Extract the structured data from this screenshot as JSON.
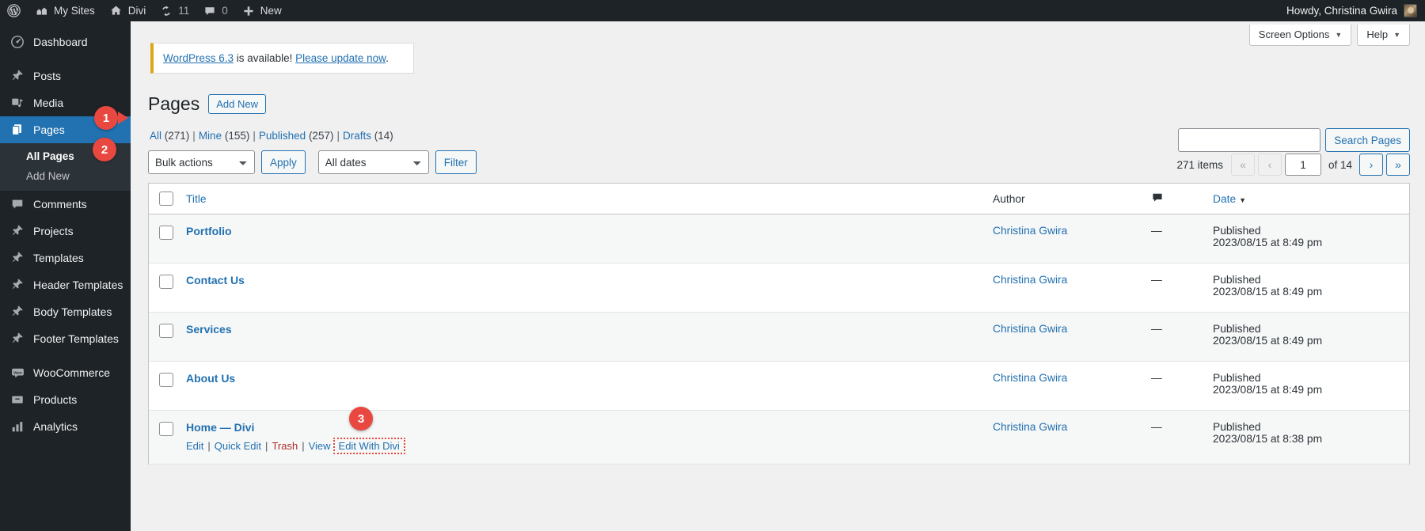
{
  "adminbar": {
    "items": [
      {
        "icon": "wordpress-logo-icon",
        "label": ""
      },
      {
        "icon": "my-sites-icon",
        "label": "My Sites"
      },
      {
        "icon": "home-icon",
        "label": "Divi"
      },
      {
        "icon": "updates-icon",
        "label": "11"
      },
      {
        "icon": "comments-bubble-icon",
        "label": "0"
      },
      {
        "icon": "plus-icon",
        "label": "New"
      }
    ],
    "howdy": "Howdy, Christina Gwira"
  },
  "sidebar": {
    "items": [
      {
        "label": "Dashboard",
        "icon": "dashboard-icon",
        "current": false
      },
      {
        "label": "Posts",
        "icon": "pin-icon",
        "current": false
      },
      {
        "label": "Media",
        "icon": "media-icon",
        "current": false
      },
      {
        "label": "Pages",
        "icon": "pages-icon",
        "current": true
      },
      {
        "label": "Comments",
        "icon": "comment-icon",
        "current": false
      },
      {
        "label": "Projects",
        "icon": "pin-icon",
        "current": false
      },
      {
        "label": "Templates",
        "icon": "pin-icon",
        "current": false
      },
      {
        "label": "Header Templates",
        "icon": "pin-icon",
        "current": false
      },
      {
        "label": "Body Templates",
        "icon": "pin-icon",
        "current": false
      },
      {
        "label": "Footer Templates",
        "icon": "pin-icon",
        "current": false
      },
      {
        "label": "WooCommerce",
        "icon": "woocommerce-icon",
        "current": false
      },
      {
        "label": "Products",
        "icon": "products-icon",
        "current": false
      },
      {
        "label": "Analytics",
        "icon": "analytics-icon",
        "current": false
      }
    ],
    "submenu": [
      {
        "label": "All Pages",
        "current": true
      },
      {
        "label": "Add New",
        "current": false
      }
    ]
  },
  "badges": {
    "one": "1",
    "two": "2",
    "three": "3"
  },
  "screen_meta": {
    "screen_options": "Screen Options",
    "help": "Help",
    "caret": "▼"
  },
  "notice": {
    "link_version": "WordPress 6.3",
    "middle": " is available! ",
    "link_update": "Please update now",
    "period": "."
  },
  "header": {
    "title": "Pages",
    "add_new": "Add New"
  },
  "filters": [
    {
      "label": "All",
      "count": "(271)"
    },
    {
      "label": "Mine",
      "count": "(155)"
    },
    {
      "label": "Published",
      "count": "(257)"
    },
    {
      "label": "Drafts",
      "count": "(14)"
    }
  ],
  "toolbar": {
    "bulk_actions": "Bulk actions",
    "apply": "Apply",
    "all_dates": "All dates",
    "filter": "Filter"
  },
  "search": {
    "value": "",
    "placeholder": "",
    "button": "Search Pages"
  },
  "pagination": {
    "items": "271 items",
    "first": "«",
    "prev": "‹",
    "current": "1",
    "of": "of 14",
    "next": "›",
    "last": "»"
  },
  "table": {
    "columns": {
      "title": "Title",
      "author": "Author",
      "comments": "comments-bubble-icon",
      "date": "Date",
      "sort_arrow": "▼"
    },
    "rows": [
      {
        "title": "Portfolio",
        "title_suffix": "",
        "author": "Christina Gwira",
        "comments": "—",
        "date_status": "Published",
        "date_value": "2023/08/15 at 8:49 pm",
        "actions": []
      },
      {
        "title": "Contact Us",
        "title_suffix": "",
        "author": "Christina Gwira",
        "comments": "—",
        "date_status": "Published",
        "date_value": "2023/08/15 at 8:49 pm",
        "actions": []
      },
      {
        "title": "Services",
        "title_suffix": "",
        "author": "Christina Gwira",
        "comments": "—",
        "date_status": "Published",
        "date_value": "2023/08/15 at 8:49 pm",
        "actions": []
      },
      {
        "title": "About Us",
        "title_suffix": "",
        "author": "Christina Gwira",
        "comments": "—",
        "date_status": "Published",
        "date_value": "2023/08/15 at 8:49 pm",
        "actions": []
      },
      {
        "title": "Home",
        "title_suffix": " — Divi",
        "author": "Christina Gwira",
        "comments": "—",
        "date_status": "Published",
        "date_value": "2023/08/15 at 8:38 pm",
        "actions": [
          {
            "label": "Edit",
            "kind": "link"
          },
          {
            "label": "Quick Edit",
            "kind": "link"
          },
          {
            "label": "Trash",
            "kind": "trash"
          },
          {
            "label": "View",
            "kind": "link"
          },
          {
            "label": "Edit With Divi",
            "kind": "highlight"
          }
        ]
      }
    ]
  },
  "colors": {
    "accent_blue": "#2271b1",
    "admin_dark": "#1d2327",
    "badge_red": "#e8483f",
    "notice_yellow": "#dba617",
    "trash_red": "#b32d2e"
  }
}
